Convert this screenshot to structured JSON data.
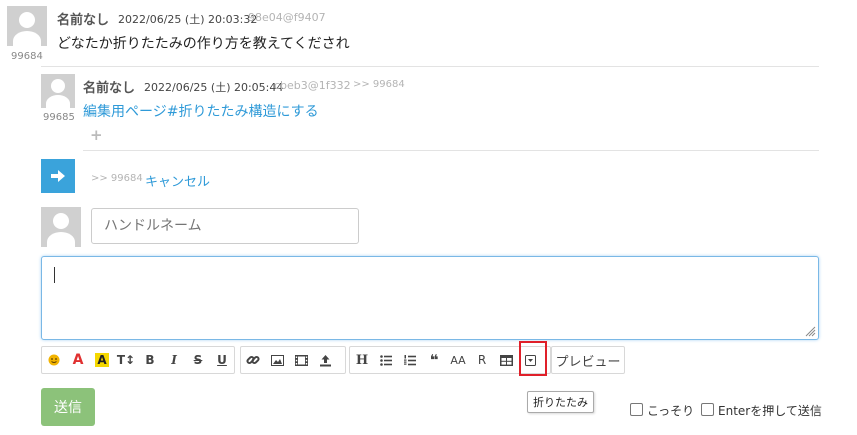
{
  "post1": {
    "number": "99684",
    "author": "名前なし",
    "datetime": "2022/06/25 (土) 20:03:32",
    "hash": "98e04@f9407",
    "body": "どなたか折りたたみの作り方を教えてくだされ"
  },
  "reply1": {
    "number": "99685",
    "author": "名前なし",
    "datetime": "2022/06/25 (土) 20:05:44",
    "hash": "cbeb3@1f332",
    "reply_ref": ">> 99684",
    "body_link": "編集用ページ#折りたたみ構造にする",
    "add_symbol": "+"
  },
  "reply_bar": {
    "reply_ref": ">> 99684",
    "cancel_label": "キャンセル"
  },
  "form": {
    "handle_placeholder": "ハンドルネーム",
    "preview_label": "プレビュー",
    "tooltip": "折りたたみ",
    "send_label": "送信",
    "stealth_label": "こっそり",
    "enter_send_label": "Enterを押して送信"
  },
  "toolbar": {
    "group1": [
      "A",
      "A",
      "T↕",
      "B",
      "I",
      "S",
      "U"
    ],
    "group3": [
      "H",
      "AA",
      "R"
    ],
    "quote": "❝"
  },
  "colors": {
    "link": "#2f9ad8",
    "send_button": "#8cc27a",
    "reply_arrow": "#3aa3db",
    "highlight": "#e0202a",
    "red_letter": "#e03030",
    "yellow_marker": "#f5d800"
  }
}
